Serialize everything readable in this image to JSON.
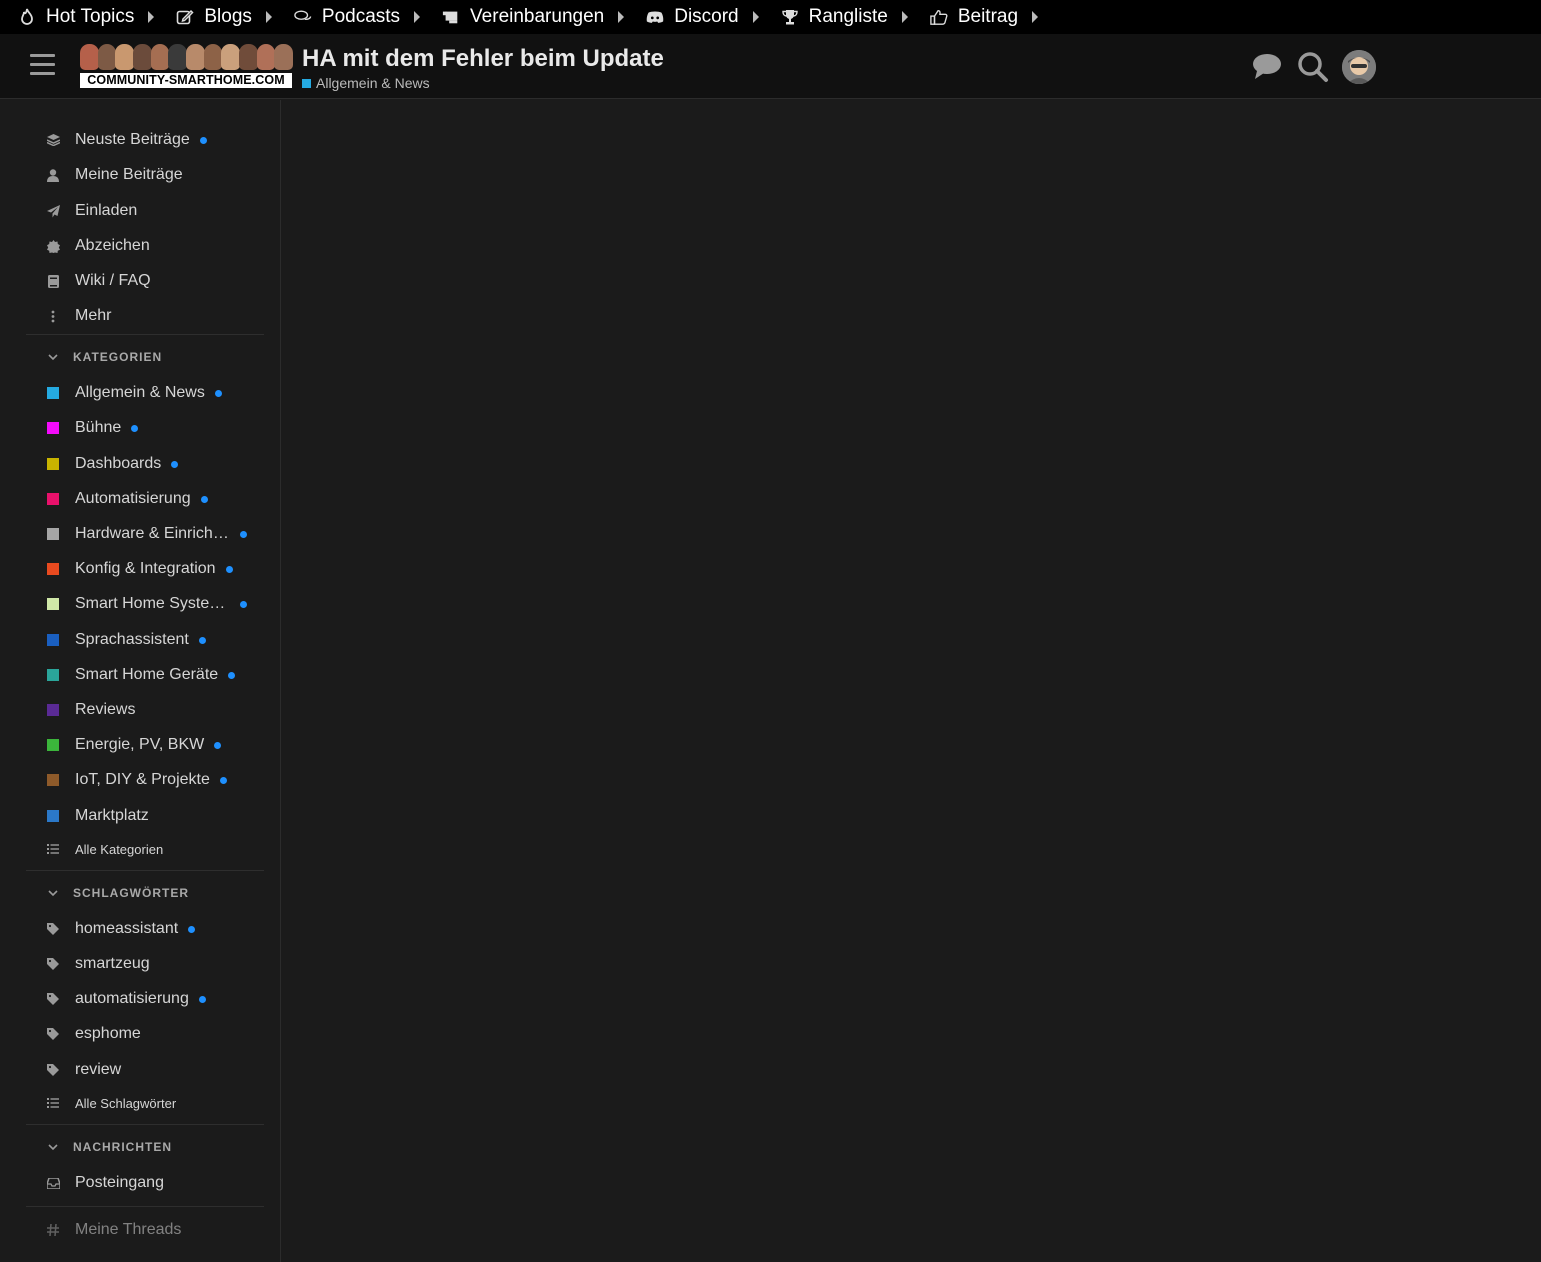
{
  "topnav": [
    {
      "label": "Hot Topics",
      "icon": "fire-icon"
    },
    {
      "label": "Blogs",
      "icon": "edit-icon"
    },
    {
      "label": "Podcasts",
      "icon": "comments-icon"
    },
    {
      "label": "Vereinbarungen",
      "icon": "scroll-icon"
    },
    {
      "label": "Discord",
      "icon": "discord-icon"
    },
    {
      "label": "Rangliste",
      "icon": "trophy-icon"
    },
    {
      "label": "Beitrag",
      "icon": "thumbs-up-icon"
    }
  ],
  "header": {
    "logo_text": "COMMUNITY-SMARTHOME.COM",
    "topic_title": "HA mit dem Fehler beim Update",
    "topic_category": "Allgemein & News",
    "topic_category_color": "#25aae1"
  },
  "sidebar": {
    "main_links": [
      {
        "label": "Neuste Beiträge",
        "icon": "layers-icon",
        "new": true
      },
      {
        "label": "Meine Beiträge",
        "icon": "user-icon",
        "new": false
      },
      {
        "label": "Einladen",
        "icon": "paper-plane-icon",
        "new": false
      },
      {
        "label": "Abzeichen",
        "icon": "certificate-icon",
        "new": false
      },
      {
        "label": "Wiki / FAQ",
        "icon": "book-icon",
        "new": false
      },
      {
        "label": "Mehr",
        "icon": "ellipsis-vertical-icon",
        "new": false
      }
    ],
    "categories_heading": "KATEGORIEN",
    "categories": [
      {
        "label": "Allgemein & News",
        "color": "#25aae1",
        "new": true
      },
      {
        "label": "Bühne",
        "color": "#f40bfb",
        "new": true
      },
      {
        "label": "Dashboards",
        "color": "#c8b400",
        "new": true
      },
      {
        "label": "Automatisierung",
        "color": "#e9116b",
        "new": true
      },
      {
        "label": "Hardware & Einrichtung",
        "color": "#a6a6a6",
        "new": true
      },
      {
        "label": "Konfig & Integration",
        "color": "#e94a1f",
        "new": true
      },
      {
        "label": "Smart Home Systeme",
        "color": "#d0e8a8",
        "new": true
      },
      {
        "label": "Sprachassistent",
        "color": "#1a5fc0",
        "new": true
      },
      {
        "label": "Smart Home Geräte",
        "color": "#2aa59a",
        "new": true
      },
      {
        "label": "Reviews",
        "color": "#5a2a95",
        "new": false
      },
      {
        "label": "Energie, PV, BKW",
        "color": "#3bb53b",
        "new": true
      },
      {
        "label": "IoT, DIY & Projekte",
        "color": "#8e5a2a",
        "new": true
      },
      {
        "label": "Marktplatz",
        "color": "#2b78c8",
        "new": false
      }
    ],
    "all_categories": "Alle Kategorien",
    "tags_heading": "SCHLAGWÖRTER",
    "tags": [
      {
        "label": "homeassistant",
        "new": true
      },
      {
        "label": "smartzeug",
        "new": false
      },
      {
        "label": "automatisierung",
        "new": true
      },
      {
        "label": "esphome",
        "new": false
      },
      {
        "label": "review",
        "new": false
      }
    ],
    "all_tags": "Alle Schlagwörter",
    "messages_heading": "NACHRICHTEN",
    "inbox": "Posteingang",
    "my_threads": "Meine Threads"
  }
}
